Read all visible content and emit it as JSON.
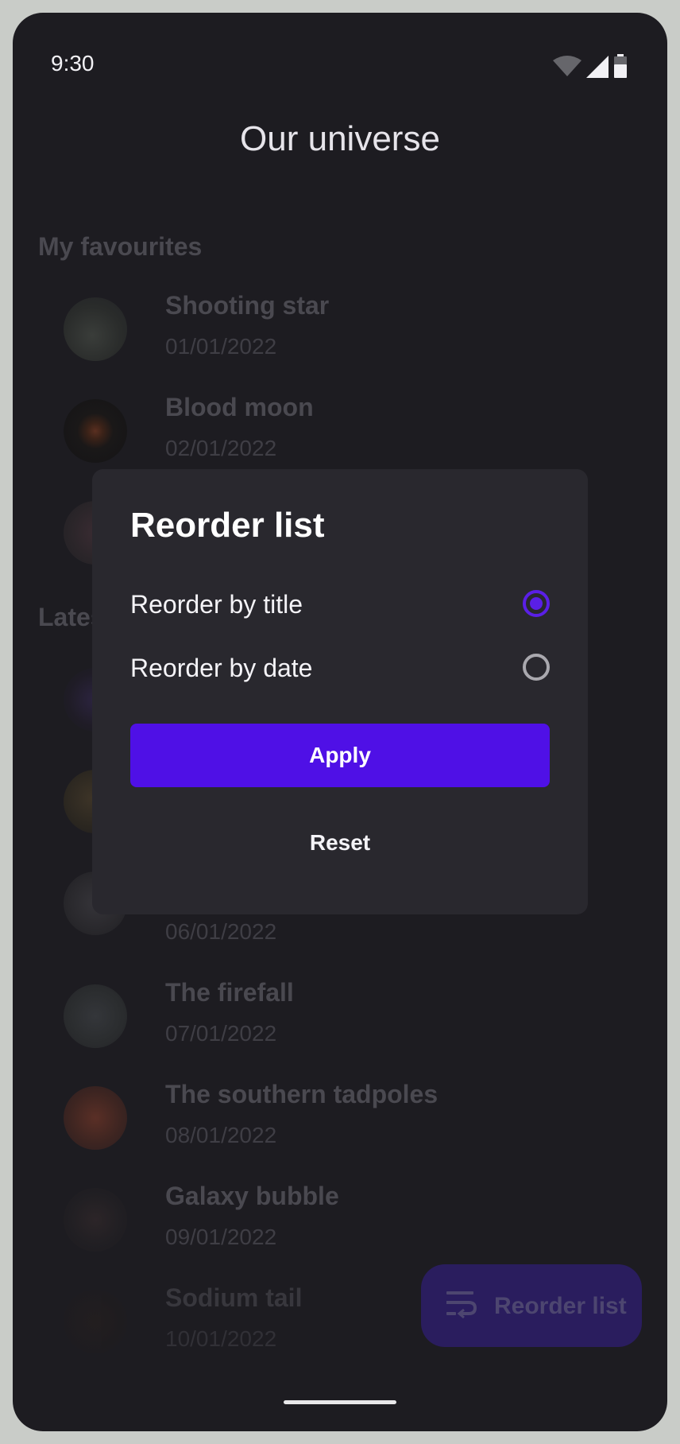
{
  "status_bar": {
    "time": "9:30",
    "icons": [
      "wifi-icon",
      "cellular-signal-icon",
      "battery-icon"
    ]
  },
  "app": {
    "title": "Our universe"
  },
  "sections": [
    {
      "header": "My favourites",
      "items": [
        {
          "title": "Shooting star",
          "date": "01/01/2022"
        },
        {
          "title": "Blood moon",
          "date": "02/01/2022"
        }
      ]
    },
    {
      "header": "Lates",
      "items": [
        {
          "title": "",
          "date": "06/01/2022"
        },
        {
          "title": "The firefall",
          "date": "07/01/2022"
        },
        {
          "title": "The southern tadpoles",
          "date": "08/01/2022"
        },
        {
          "title": "Galaxy bubble",
          "date": "09/01/2022"
        },
        {
          "title": "Sodium tail",
          "date": "10/01/2022"
        }
      ]
    }
  ],
  "fab": {
    "label": "Reorder list",
    "icon": "sort-icon"
  },
  "dialog": {
    "title": "Reorder list",
    "options": [
      {
        "label": "Reorder by title",
        "selected": true
      },
      {
        "label": "Reorder by date",
        "selected": false
      }
    ],
    "apply_label": "Apply",
    "reset_label": "Reset"
  },
  "colors": {
    "background": "#1d1c21",
    "dialog_surface": "#29282e",
    "accent": "#4f10e6",
    "radio_selected": "#5a1fe6",
    "fab_background": "#2a1d5e"
  }
}
